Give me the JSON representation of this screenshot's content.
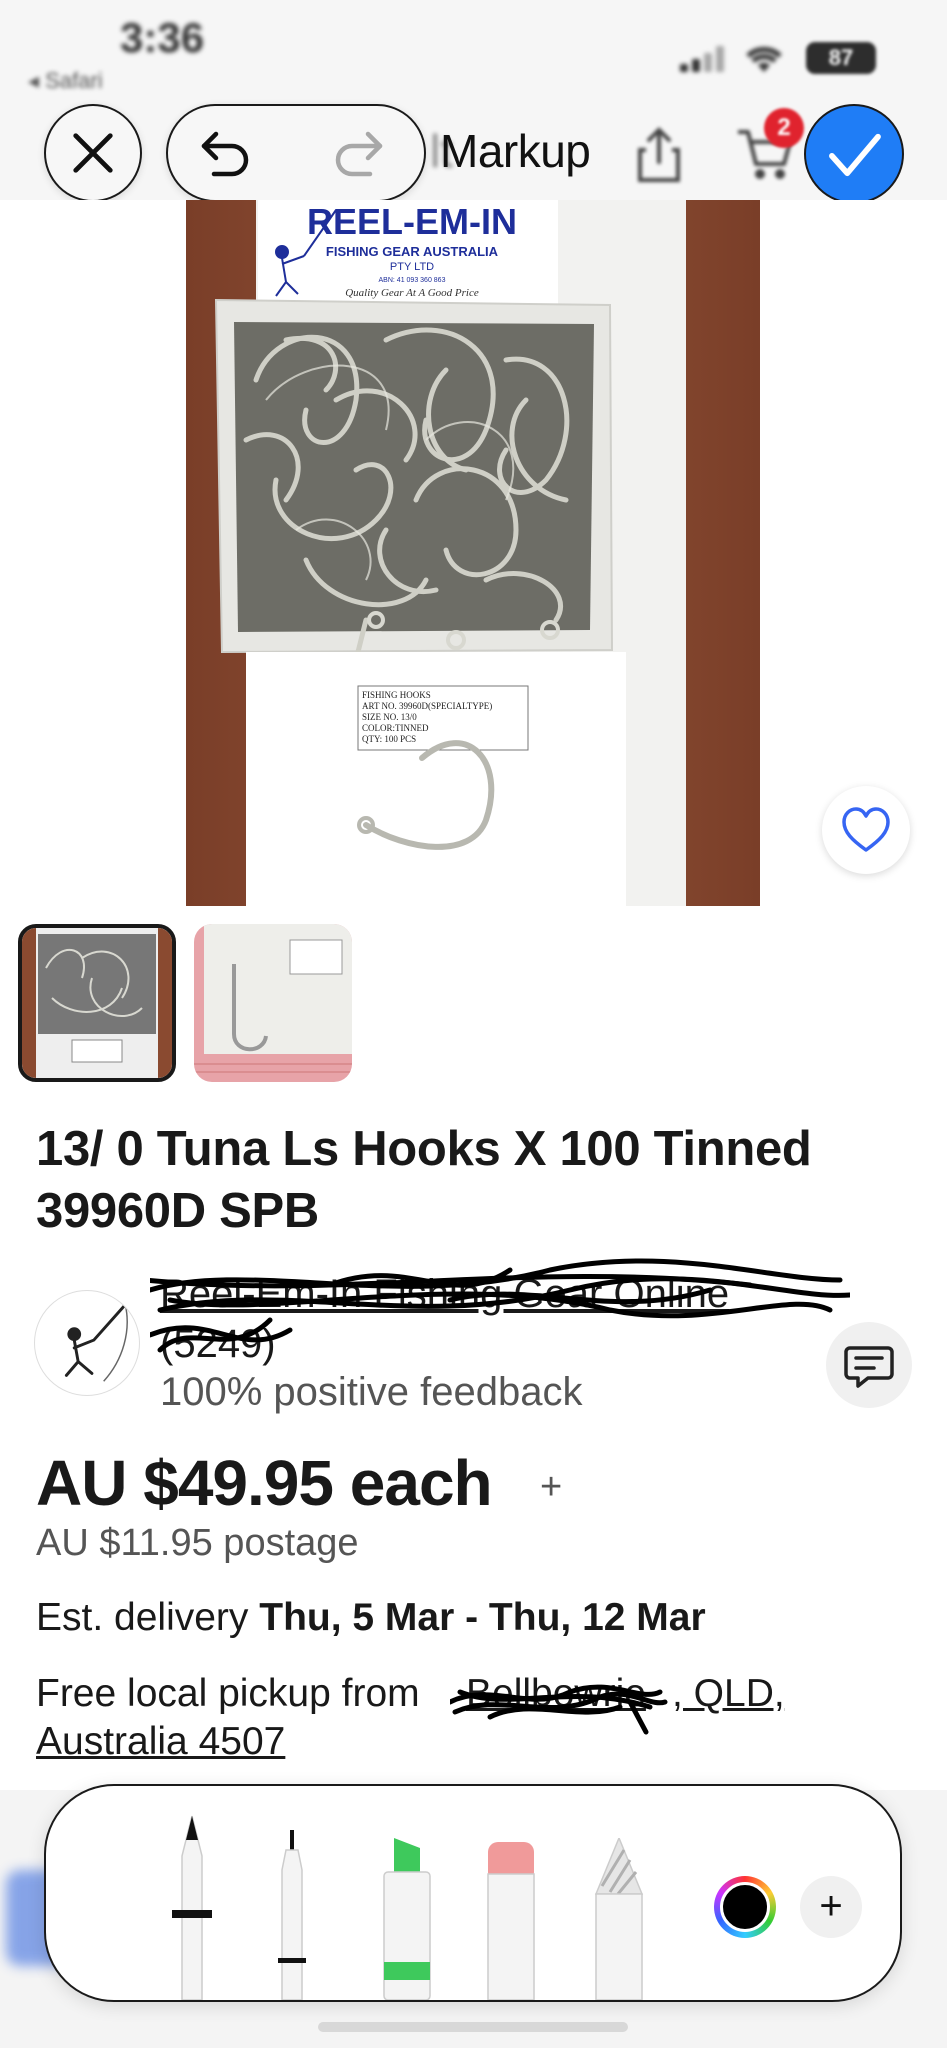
{
  "status_bar": {
    "time": "3:36",
    "back_app": "◂ Safari",
    "battery": "87"
  },
  "markup_toolbar": {
    "title": "Markup",
    "ghost_prefix": "lt",
    "cart_badge": "2"
  },
  "photo": {
    "box_brand": "REEL-EM-IN",
    "box_company_line1": "FISHING GEAR AUSTRALIA",
    "box_company_line2": "PTY LTD",
    "box_abn": "ABN: 41 093 360 863",
    "box_tagline": "Quality Gear At A Good Price",
    "label_lines": [
      "FISHING HOOKS",
      "ART NO. 39960D(SPECIALTYPE)",
      "SIZE NO. 13/0",
      "COLOR:TINNED",
      "QTY: 100 PCS"
    ]
  },
  "listing": {
    "title": "13/ 0  Tuna Ls Hooks X 100 Tinned 39960D SPB",
    "seller_name": "Reel-Em-In Fishing Gear Online",
    "seller_count": "(5249)",
    "feedback": "100% positive feedback",
    "price": "AU $49.95 each",
    "price_plus": "+",
    "postage": "AU $11.95 postage",
    "delivery_prefix": "Est. delivery ",
    "delivery_dates": "Thu, 5 Mar - Thu, 12 Mar",
    "pickup_prefix": "Free local pickup from ",
    "pickup_suburb": "Bellbowrie",
    "pickup_state": ", QLD,",
    "pickup_country": "Australia 4507"
  },
  "tools": {
    "items": [
      "pen",
      "fineliner",
      "highlighter",
      "eraser",
      "pencil"
    ],
    "add_symbol": "+"
  },
  "colors": {
    "accent_blue": "#1f7df6",
    "badge_red": "#e0232e",
    "highlighter_green": "#3ec95c",
    "eraser_pink": "#f09a9a"
  }
}
